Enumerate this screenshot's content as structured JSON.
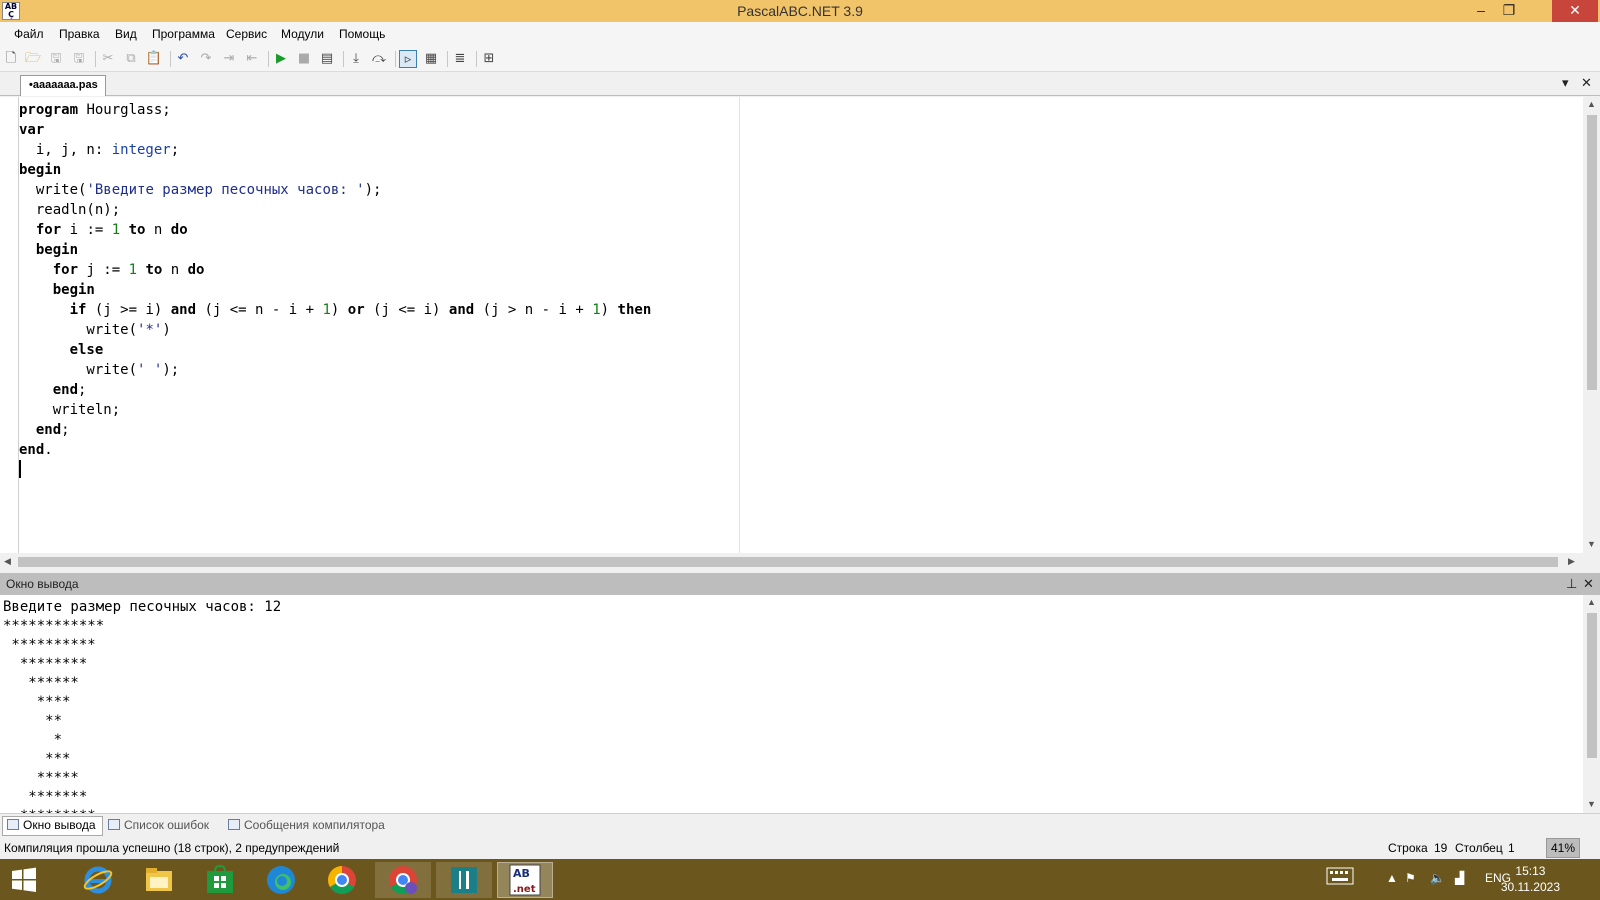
{
  "window": {
    "title": "PascalABC.NET 3.9",
    "app_icon_text": "AB\nC.net",
    "minimize": "–",
    "restore": "❐",
    "close": "✕"
  },
  "menu": {
    "items": [
      "Файл",
      "Правка",
      "Вид",
      "Программа",
      "Сервис",
      "Модули",
      "Помощь"
    ]
  },
  "toolbar": {
    "icons": [
      "new-file-icon",
      "open-icon",
      "save-icon",
      "save-all-icon",
      "cut-icon",
      "copy-icon",
      "paste-icon",
      "undo-icon",
      "redo-icon",
      "indent-icon",
      "outdent-icon",
      "run-icon",
      "stop-icon",
      "compile-icon",
      "step-into-icon",
      "step-over-icon",
      "console-icon",
      "debug-icon",
      "format-icon",
      "designer-icon"
    ]
  },
  "tabs": {
    "active_file": "•aaaaaaa.pas",
    "dropdown": "▾",
    "close": "✕"
  },
  "editor": {
    "language": "Pascal",
    "lines": [
      "program Hourglass;",
      "var",
      "  i, j, n: integer;",
      "begin",
      "  write('Введите размер песочных часов: ');",
      "  readln(n);",
      "  for i := 1 to n do",
      "  begin",
      "    for j := 1 to n do",
      "    begin",
      "      if (j >= i) and (j <= n - i + 1) or (j <= i) and (j > n - i + 1) then",
      "        write('*')",
      "      else",
      "        write(' ');",
      "    end;",
      "    writeln;",
      "  end;",
      "end.",
      ""
    ]
  },
  "output_panel": {
    "title": "Окно вывода",
    "pin": "⊥",
    "close": "✕",
    "lines": [
      "Введите размер песочных часов: 12",
      "************",
      " **********",
      "  ********",
      "   ******",
      "    ****",
      "     **",
      "      *",
      "     ***",
      "    *****",
      "   *******",
      "  *********"
    ]
  },
  "bottom_tabs": {
    "items": [
      "Окно вывода",
      "Список ошибок",
      "Сообщения компилятора"
    ]
  },
  "status": {
    "message": "Компиляция прошла успешно (18 строк), 2 предупреждений",
    "row_label": "Строка",
    "row_value": "19",
    "col_label": "Столбец",
    "col_value": "1",
    "zoom": "41%"
  },
  "taskbar": {
    "apps": [
      "windows-start-icon",
      "internet-explorer-icon",
      "file-explorer-icon",
      "store-icon",
      "edge-icon",
      "chrome-icon",
      "chrome-profile-icon",
      "restaurant-app-icon",
      "pascalabc-icon"
    ],
    "keyboard_icon": "keyboard-icon",
    "language": "ENG",
    "time": "15:13",
    "date": "30.11.2023"
  }
}
